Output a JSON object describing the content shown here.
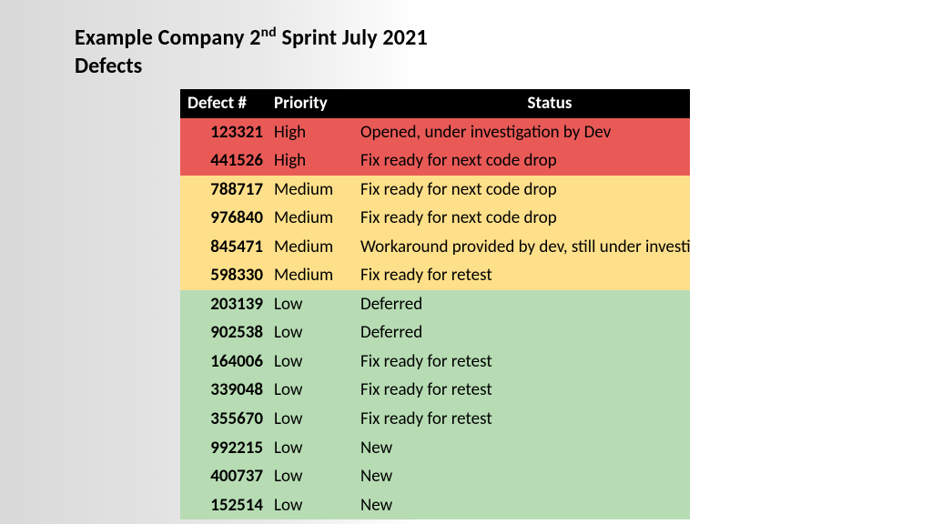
{
  "title": {
    "line1_pre": "Example Company  2",
    "line1_sup": "nd",
    "line1_post": " Sprint July 2021",
    "line2": "Defects"
  },
  "table": {
    "headers": {
      "defect": "Defect #",
      "priority": "Priority",
      "status": "Status"
    },
    "rows": [
      {
        "defect": "123321",
        "priority": "High",
        "status": "Opened, under investigation by Dev",
        "level": "high"
      },
      {
        "defect": "441526",
        "priority": "High",
        "status": "Fix ready for next code drop",
        "level": "high"
      },
      {
        "defect": "788717",
        "priority": "Medium",
        "status": "Fix ready for next code drop",
        "level": "medium"
      },
      {
        "defect": "976840",
        "priority": "Medium",
        "status": "Fix ready for next code drop",
        "level": "medium"
      },
      {
        "defect": "845471",
        "priority": "Medium",
        "status": "Workaround provided by dev, still under investigation",
        "level": "medium"
      },
      {
        "defect": "598330",
        "priority": "Medium",
        "status": "Fix ready for retest",
        "level": "medium"
      },
      {
        "defect": "203139",
        "priority": "Low",
        "status": "Deferred",
        "level": "low"
      },
      {
        "defect": "902538",
        "priority": "Low",
        "status": "Deferred",
        "level": "low"
      },
      {
        "defect": "164006",
        "priority": "Low",
        "status": "Fix ready for retest",
        "level": "low"
      },
      {
        "defect": "339048",
        "priority": "Low",
        "status": "Fix ready for retest",
        "level": "low"
      },
      {
        "defect": "355670",
        "priority": "Low",
        "status": "Fix ready for retest",
        "level": "low"
      },
      {
        "defect": "992215",
        "priority": "Low",
        "status": "New",
        "level": "low"
      },
      {
        "defect": "400737",
        "priority": "Low",
        "status": "New",
        "level": "low"
      },
      {
        "defect": "152514",
        "priority": "Low",
        "status": "New",
        "level": "low"
      }
    ]
  },
  "colors": {
    "high": "#e95a57",
    "medium": "#ffe08a",
    "low": "#b7dcb4"
  }
}
